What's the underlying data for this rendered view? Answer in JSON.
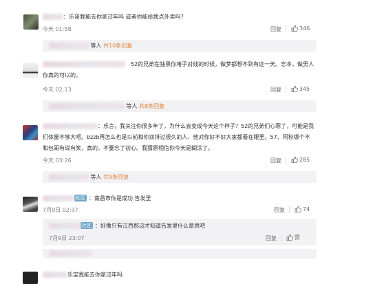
{
  "ui": {
    "reply_label": "回复",
    "colors": {
      "link_orange": "#e3823b",
      "bg_sub": "#f2f2f5",
      "tag_blue": "#72a7c9"
    }
  },
  "comments": [
    {
      "text": "：乐哥我能去你家过年吗 或者你能给我点外卖吗?",
      "time": "今天 01:58",
      "likes": "346",
      "sub_suffix": "等人",
      "sub_count": "共10条回复"
    },
    {
      "text": "52的兄弟在独黑你堵子对线的时候，做梦都想不到有这一天。忘本，做男人你真的可以的。",
      "time": "今天 02:13",
      "likes": "345",
      "sub_suffix": "等人",
      "sub_count": "共8条回复"
    },
    {
      "text": "：乐言，我关注你很多年了，为什么会变成今天这个样子？52的兄弟们心寒了，可能是我们体量不够大吧。bzzb再怎么也是以前和你双排过很久的人，他对你好不好大家都看在眼里。57、阿秋哪个不和包哥有说有笑，真的，不要忘了初心。我猜原相信你今天是糊涂了。",
      "time": "今天 03:26",
      "likes": "285",
      "sub_suffix": "等人",
      "sub_count": "共9条回复"
    },
    {
      "tag": "社区",
      "text": "：南昌市你是成功 告发里",
      "time": "7月9日 02:37",
      "likes": "74"
    }
  ],
  "nested_reply": {
    "tag": "社区",
    "text": "：好像只有江西那边才知道告发里什么意思吧",
    "time": "7月9日 23:07",
    "likes": "赞"
  },
  "last_comment": {
    "text": "乐宝我能去你家过年吗"
  }
}
